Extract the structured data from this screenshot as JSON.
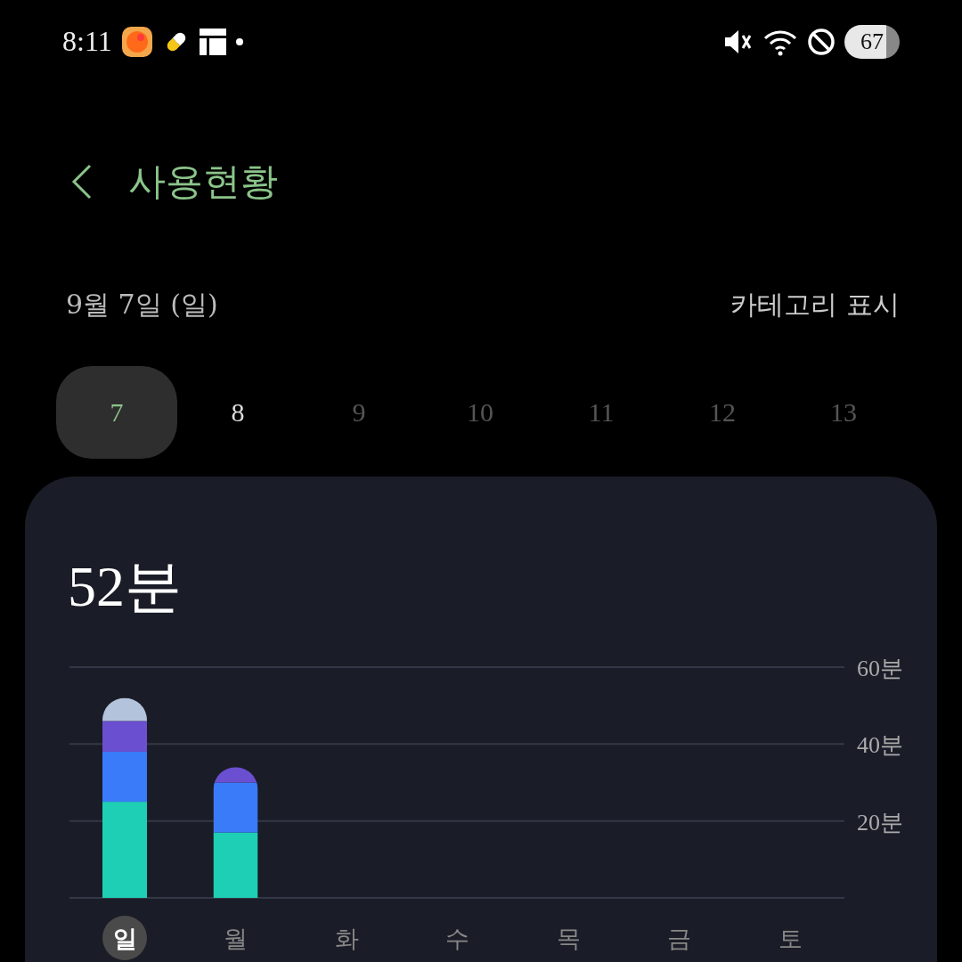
{
  "status_bar": {
    "time": "8:11",
    "battery": "67"
  },
  "header": {
    "title": "사용현황"
  },
  "date_row": {
    "date": "9월 7일 (일)",
    "category_toggle": "카테고리 표시"
  },
  "days": [
    {
      "label": "7",
      "selected": true,
      "disabled": false
    },
    {
      "label": "8",
      "selected": false,
      "disabled": false
    },
    {
      "label": "9",
      "selected": false,
      "disabled": true
    },
    {
      "label": "10",
      "selected": false,
      "disabled": true
    },
    {
      "label": "11",
      "selected": false,
      "disabled": true
    },
    {
      "label": "12",
      "selected": false,
      "disabled": true
    },
    {
      "label": "13",
      "selected": false,
      "disabled": true
    }
  ],
  "usage_card": {
    "total": "52분",
    "weekdays": [
      {
        "label": "일",
        "selected": true
      },
      {
        "label": "월",
        "selected": false
      },
      {
        "label": "화",
        "selected": false
      },
      {
        "label": "수",
        "selected": false
      },
      {
        "label": "목",
        "selected": false
      },
      {
        "label": "금",
        "selected": false
      },
      {
        "label": "토",
        "selected": false
      }
    ],
    "chart_data": {
      "type": "bar",
      "stacked": true,
      "ylim": [
        0,
        60
      ],
      "yticks": [
        {
          "value": 20,
          "label": "20분"
        },
        {
          "value": 40,
          "label": "40분"
        },
        {
          "value": 60,
          "label": "60분"
        }
      ],
      "series": [
        {
          "color": "#1fcfb5",
          "values": [
            25,
            17,
            null,
            null,
            null,
            null,
            null
          ]
        },
        {
          "color": "#3a7bfa",
          "values": [
            13,
            13,
            null,
            null,
            null,
            null,
            null
          ]
        },
        {
          "color": "#6a4fd0",
          "values": [
            8,
            4,
            null,
            null,
            null,
            null,
            null
          ]
        },
        {
          "color": "#b3c3dc",
          "values": [
            6,
            null,
            null,
            null,
            null,
            null,
            null
          ]
        }
      ]
    }
  }
}
